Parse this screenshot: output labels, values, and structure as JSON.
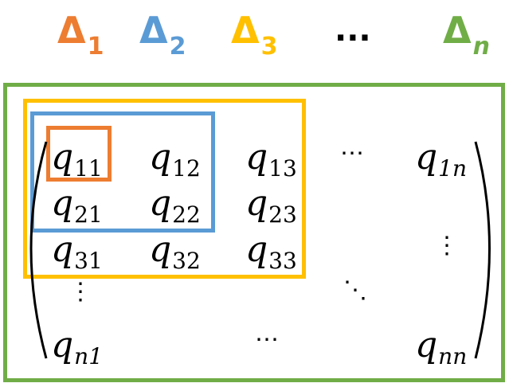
{
  "headers": [
    {
      "symbol": "Δ",
      "sub": "1",
      "color": "#ED7D31"
    },
    {
      "symbol": "Δ",
      "sub": "2",
      "color": "#5B9BD5"
    },
    {
      "symbol": "Δ",
      "sub": "3",
      "color": "#FFC000"
    },
    {
      "symbol": "Δ",
      "sub": "n",
      "color": "#70AD47"
    }
  ],
  "header_ellipsis": "...",
  "matrix": {
    "cells": [
      {
        "base": "q",
        "sub": "11"
      },
      {
        "base": "q",
        "sub": "12"
      },
      {
        "base": "q",
        "sub": "13"
      },
      {
        "base": "q",
        "sub": "1n"
      },
      {
        "base": "q",
        "sub": "21"
      },
      {
        "base": "q",
        "sub": "22"
      },
      {
        "base": "q",
        "sub": "23"
      },
      {
        "base": "q",
        "sub": "31"
      },
      {
        "base": "q",
        "sub": "32"
      },
      {
        "base": "q",
        "sub": "33"
      },
      {
        "base": "q",
        "sub": "n1"
      },
      {
        "base": "q",
        "sub": "nn"
      }
    ],
    "hdots": "⋯",
    "vdots": "⋮",
    "ddots": "⋱"
  },
  "colors": {
    "orange": "#ED7D31",
    "blue": "#5B9BD5",
    "yellow": "#FFC000",
    "green": "#70AD47",
    "text": "#000000"
  }
}
